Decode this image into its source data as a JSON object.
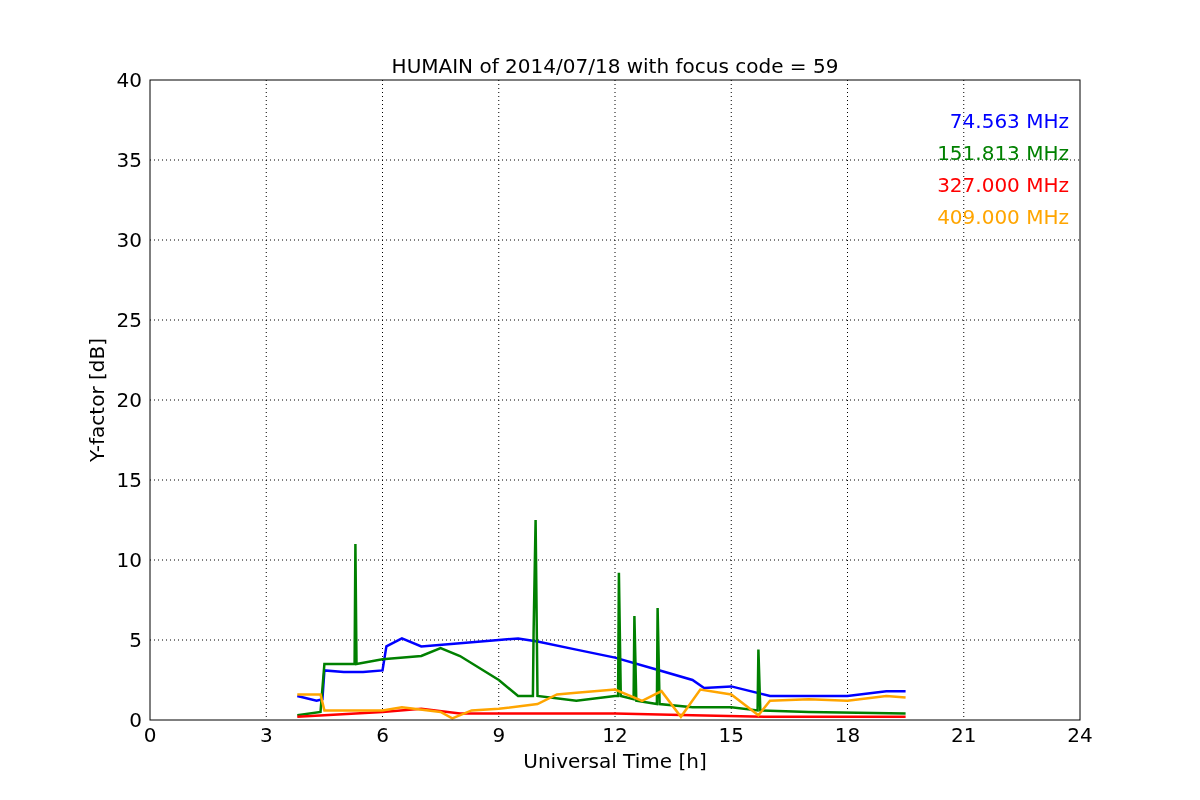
{
  "chart_data": {
    "type": "line",
    "title": "HUMAIN of 2014/07/18 with focus code = 59",
    "xlabel": "Universal Time [h]",
    "ylabel": "Y-factor [dB]",
    "grid": true,
    "xlim": [
      0,
      24
    ],
    "ylim": [
      0,
      40
    ],
    "xticks": [
      0,
      3,
      6,
      9,
      12,
      15,
      18,
      21,
      24
    ],
    "yticks": [
      0,
      5,
      10,
      15,
      20,
      25,
      30,
      35,
      40
    ],
    "series": [
      {
        "name": "74.563 MHz",
        "color": "#0000ff",
        "x": [
          3.8,
          4.3,
          4.45,
          4.5,
          5,
          5.5,
          6,
          6.1,
          6.5,
          7,
          8,
          9,
          9.5,
          10,
          11,
          12,
          13,
          14,
          14.3,
          15,
          16,
          17,
          18,
          19,
          19.5
        ],
        "values": [
          1.5,
          1.2,
          1.3,
          3.1,
          3.0,
          3.0,
          3.1,
          4.6,
          5.1,
          4.6,
          4.8,
          5.0,
          5.1,
          4.9,
          4.4,
          3.9,
          3.2,
          2.5,
          2.0,
          2.1,
          1.5,
          1.5,
          1.5,
          1.8,
          1.8
        ]
      },
      {
        "name": "151.813 MHz",
        "color": "#008000",
        "x": [
          3.8,
          4.4,
          4.5,
          5,
          5.28,
          5.3,
          5.33,
          6,
          7,
          7.5,
          8,
          9,
          9.5,
          9.88,
          9.9,
          9.95,
          10,
          11,
          12,
          12.08,
          12.1,
          12.15,
          12.48,
          12.5,
          12.55,
          13.08,
          13.1,
          13.15,
          14,
          15,
          15.68,
          15.7,
          15.75,
          17,
          19.5
        ],
        "values": [
          0.3,
          0.5,
          3.5,
          3.5,
          3.5,
          11,
          3.5,
          3.8,
          4.0,
          4.5,
          4.0,
          2.5,
          1.5,
          1.5,
          5.5,
          12.5,
          1.5,
          1.2,
          1.5,
          1.5,
          9.2,
          1.5,
          1.3,
          6.5,
          1.2,
          1.0,
          7.0,
          1.0,
          0.8,
          0.8,
          0.6,
          4.4,
          0.6,
          0.5,
          0.4
        ]
      },
      {
        "name": "327.000 MHz",
        "color": "#ff0000",
        "x": [
          3.8,
          4.5,
          6,
          7,
          8,
          10,
          12,
          14,
          16,
          19.5
        ],
        "values": [
          0.2,
          0.3,
          0.5,
          0.7,
          0.4,
          0.4,
          0.4,
          0.3,
          0.2,
          0.2
        ]
      },
      {
        "name": "409.000 MHz",
        "color": "#ffa500",
        "x": [
          3.8,
          4.4,
          4.5,
          6,
          6.5,
          7.5,
          7.8,
          8.3,
          9,
          10,
          10.5,
          11,
          12,
          12.7,
          13.2,
          13.7,
          14.2,
          15,
          15.7,
          16,
          17,
          18,
          19,
          19.5
        ],
        "values": [
          1.6,
          1.6,
          0.6,
          0.6,
          0.8,
          0.5,
          0.1,
          0.6,
          0.7,
          1.0,
          1.6,
          1.7,
          1.9,
          1.2,
          1.8,
          0.2,
          1.9,
          1.6,
          0.3,
          1.2,
          1.3,
          1.2,
          1.5,
          1.4
        ]
      }
    ]
  }
}
